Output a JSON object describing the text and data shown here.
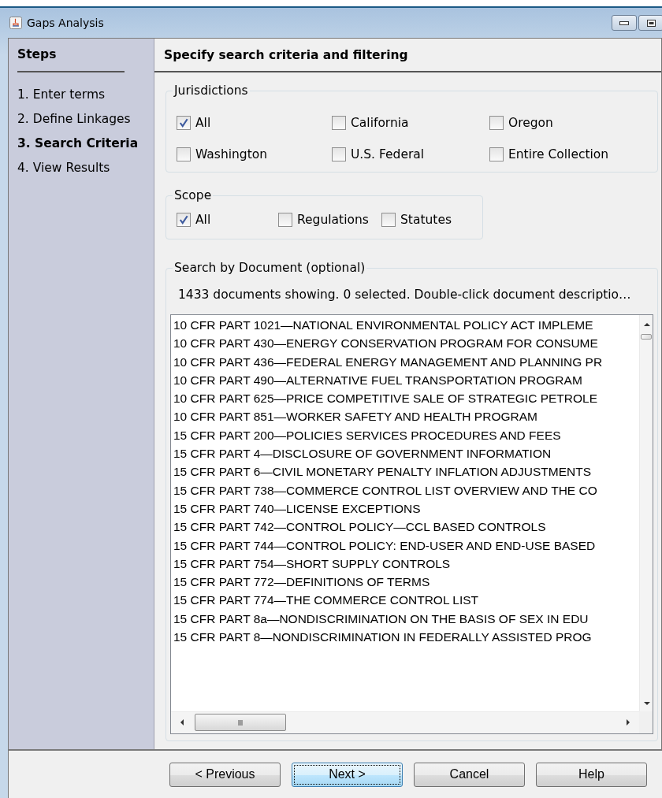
{
  "window": {
    "title": "Gaps Analysis"
  },
  "sidebar": {
    "title": "Steps",
    "items": [
      {
        "label": "1. Enter terms",
        "selected": false
      },
      {
        "label": "2. Define Linkages",
        "selected": false
      },
      {
        "label": "3. Search Criteria",
        "selected": true
      },
      {
        "label": "4. View Results",
        "selected": false
      }
    ]
  },
  "header": "Specify search criteria and filtering",
  "jurisdictions": {
    "title": "Jurisdictions",
    "options": [
      {
        "label": "All",
        "checked": true
      },
      {
        "label": "California",
        "checked": false
      },
      {
        "label": "Oregon",
        "checked": false
      },
      {
        "label": "Washington",
        "checked": false
      },
      {
        "label": "U.S. Federal",
        "checked": false
      },
      {
        "label": "Entire Collection",
        "checked": false
      }
    ]
  },
  "scope": {
    "title": "Scope",
    "options": [
      {
        "label": "All",
        "checked": true
      },
      {
        "label": "Regulations",
        "checked": false
      },
      {
        "label": "Statutes",
        "checked": false
      }
    ]
  },
  "documents": {
    "title": "Search by Document (optional)",
    "status": "1433 documents showing. 0 selected.  Double-click document descriptio…",
    "items": [
      "10 CFR PART 1021—NATIONAL ENVIRONMENTAL POLICY ACT IMPLEME",
      "10 CFR PART 430—ENERGY CONSERVATION PROGRAM FOR CONSUME",
      "10 CFR PART 436—FEDERAL ENERGY MANAGEMENT AND PLANNING PR",
      "10 CFR PART 490—ALTERNATIVE FUEL TRANSPORTATION PROGRAM",
      "10 CFR PART 625—PRICE COMPETITIVE SALE OF STRATEGIC PETROLE",
      "10 CFR PART 851—WORKER SAFETY AND HEALTH PROGRAM",
      "15 CFR PART 200—POLICIES SERVICES PROCEDURES AND FEES",
      "15 CFR PART 4—DISCLOSURE OF GOVERNMENT INFORMATION",
      "15 CFR PART 6—CIVIL MONETARY PENALTY INFLATION ADJUSTMENTS",
      "15 CFR PART 738—COMMERCE CONTROL LIST OVERVIEW AND THE CO",
      "15 CFR PART 740—LICENSE EXCEPTIONS",
      "15 CFR PART 742—CONTROL POLICY—CCL BASED CONTROLS",
      "15 CFR PART 744—CONTROL POLICY: END-USER AND END-USE BASED",
      "15 CFR PART 754—SHORT SUPPLY CONTROLS",
      "15 CFR PART 772—DEFINITIONS OF TERMS",
      "15 CFR PART 774—THE COMMERCE CONTROL LIST",
      "15 CFR PART 8a—NONDISCRIMINATION ON THE BASIS OF SEX IN EDU",
      "15 CFR PART 8—NONDISCRIMINATION IN FEDERALLY ASSISTED PROG"
    ]
  },
  "buttons": [
    {
      "label": "< Previous",
      "selected": false
    },
    {
      "label": "Next >",
      "selected": true
    },
    {
      "label": "Cancel",
      "selected": false
    },
    {
      "label": "Help",
      "selected": false
    }
  ]
}
